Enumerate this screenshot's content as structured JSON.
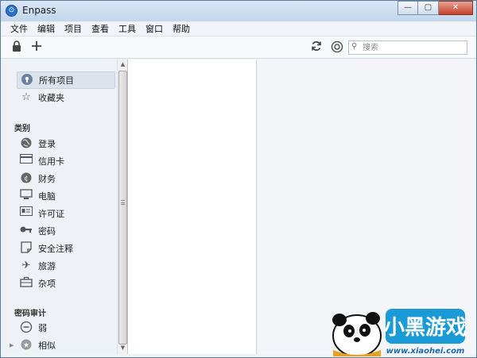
{
  "window": {
    "title": "Enpass",
    "icon": "enpass-logo-icon"
  },
  "titlebar_buttons": {
    "minimize": "—",
    "maximize": "▢",
    "close": "✕"
  },
  "menu": [
    "文件",
    "编辑",
    "项目",
    "查看",
    "工具",
    "窗口",
    "帮助"
  ],
  "toolbar": {
    "lock_icon": "lock-icon",
    "add_icon": "plus-icon",
    "sync_icon": "sync-icon",
    "settings_icon": "gear-icon",
    "search_placeholder": "搜索"
  },
  "sidebar": {
    "top_items": [
      {
        "label": "所有项目",
        "icon": "vault-icon",
        "active": true
      },
      {
        "label": "收藏夹",
        "icon": "star-icon",
        "active": false
      }
    ],
    "category_header": "类别",
    "categories": [
      {
        "label": "登录",
        "icon": "globe-icon"
      },
      {
        "label": "信用卡",
        "icon": "credit-card-icon"
      },
      {
        "label": "财务",
        "icon": "finance-icon"
      },
      {
        "label": "电脑",
        "icon": "computer-icon"
      },
      {
        "label": "许可证",
        "icon": "license-icon"
      },
      {
        "label": "密码",
        "icon": "key-icon"
      },
      {
        "label": "安全注释",
        "icon": "note-icon"
      },
      {
        "label": "旅游",
        "icon": "airplane-icon"
      },
      {
        "label": "杂项",
        "icon": "briefcase-icon"
      }
    ],
    "audit_header": "密码审计",
    "audit_items": [
      {
        "label": "弱",
        "icon": "weak-icon"
      },
      {
        "label": "相似",
        "icon": "similar-icon"
      }
    ]
  },
  "watermark": {
    "brand_text": "小黑游戏",
    "url": "www.xiaohei.com"
  }
}
